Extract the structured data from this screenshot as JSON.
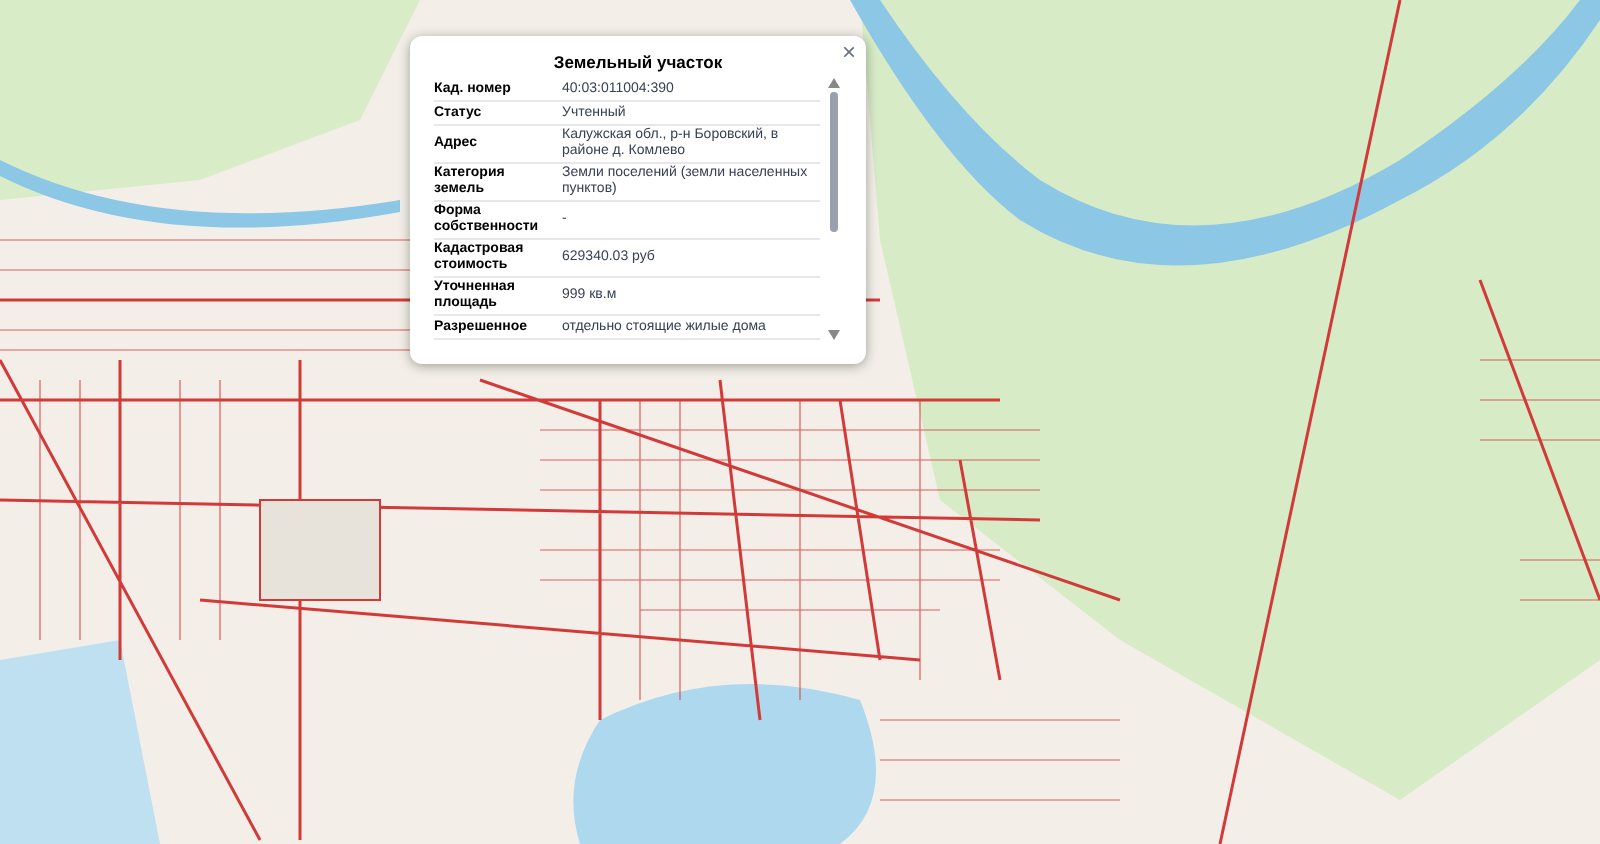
{
  "popup": {
    "title": "Земельный участок",
    "close": "×",
    "rows": [
      {
        "label": "Кад. номер",
        "value": "40:03:011004:390"
      },
      {
        "label": "Статус",
        "value": "Учтенный"
      },
      {
        "label": "Адрес",
        "value": "Калужская обл., р-н Боровский, в районе д. Комлево"
      },
      {
        "label": "Категория земель",
        "value": "Земли поселений (земли населенных пунктов)"
      },
      {
        "label": "Форма собственности",
        "value": "-"
      },
      {
        "label": "Кадастровая стоимость",
        "value": "629340.03 руб"
      },
      {
        "label": "Уточненная площадь",
        "value": "999 кв.м"
      },
      {
        "label": "Разрешенное",
        "value": "отдельно стоящие жилые дома"
      }
    ]
  }
}
